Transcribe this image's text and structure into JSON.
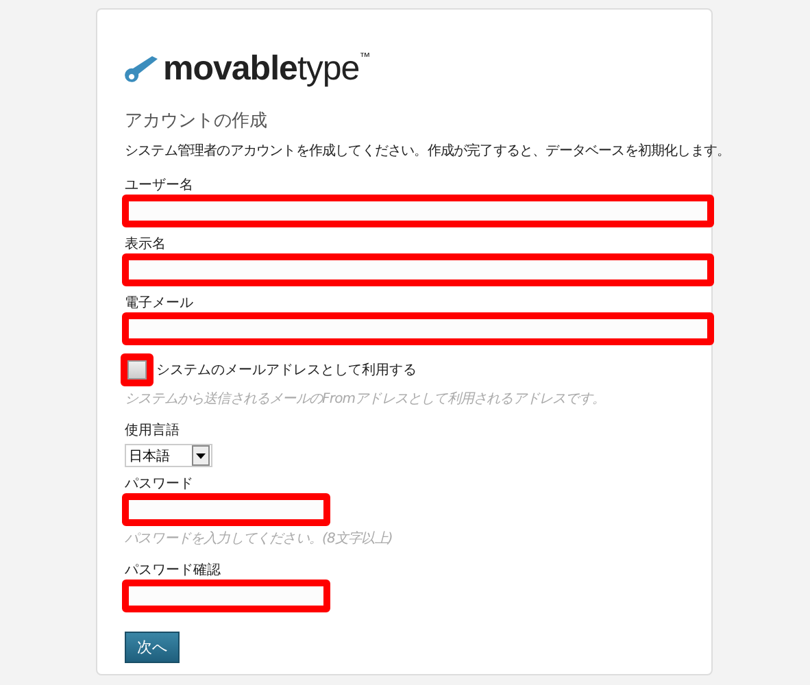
{
  "logo": {
    "text_bold": "movable",
    "text_light": "type",
    "mark": "™"
  },
  "title": "アカウントの作成",
  "description": "システム管理者のアカウントを作成してください。作成が完了すると、データベースを初期化します。",
  "fields": [
    {
      "kind": "text",
      "label": "ユーザー名",
      "highlighted": true
    },
    {
      "kind": "text",
      "label": "表示名",
      "highlighted": true
    },
    {
      "kind": "text",
      "label": "電子メール",
      "highlighted": true
    },
    {
      "kind": "checkbox",
      "label": "システムのメールアドレスとして利用する",
      "checked": false,
      "highlighted": true,
      "hint": "システムから送信されるメールのFromアドレスとして利用されるアドレスです。"
    },
    {
      "kind": "select",
      "label": "使用言語",
      "value": "日本語"
    },
    {
      "kind": "password",
      "label": "パスワード",
      "highlighted": true,
      "hint": "パスワードを入力してください。(8文字以上)"
    },
    {
      "kind": "password",
      "label": "パスワード確認",
      "highlighted": true
    }
  ],
  "button": "次へ"
}
